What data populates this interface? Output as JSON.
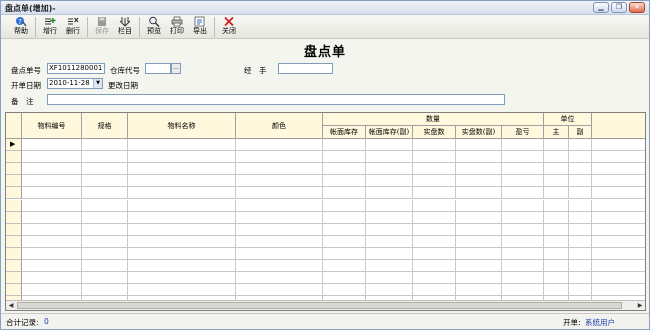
{
  "window": {
    "title": "盘点单(增加)-"
  },
  "toolbar": {
    "buttons": [
      {
        "label": "帮助",
        "icon": "help-icon"
      },
      {
        "label": "增行",
        "icon": "add-row-icon"
      },
      {
        "label": "删行",
        "icon": "delete-row-icon"
      },
      {
        "label": "保存",
        "icon": "save-icon"
      },
      {
        "label": "栏目",
        "icon": "columns-icon"
      },
      {
        "label": "预览",
        "icon": "preview-icon"
      },
      {
        "label": "打印",
        "icon": "print-icon"
      },
      {
        "label": "导出",
        "icon": "export-icon"
      },
      {
        "label": "关闭",
        "icon": "close-icon"
      }
    ]
  },
  "heading": "盘点单",
  "form": {
    "doc_no_label": "盘点单号",
    "doc_no_value": "XF1011280001",
    "warehouse_label": "仓库代号",
    "warehouse_value": "",
    "handler_label": "经　手",
    "handler_value": "",
    "date_label": "开单日期",
    "date_value": "2010-11-28",
    "change_date_label": "更改日期",
    "remark_label": "备　注",
    "remark_value": ""
  },
  "grid": {
    "headers": {
      "item_no": "物料编号",
      "spec": "规格",
      "item_name": "物料名称",
      "color": "颜色",
      "qty_group": "数量",
      "book_stock": "帐面库存",
      "book_stock_sub": "帐面库存(副)",
      "actual": "实盘数",
      "actual_sub": "实盘数(副)",
      "diff": "盈亏",
      "unit_group": "单位",
      "unit_main": "主",
      "unit_sub": "副"
    },
    "row_marker": "▶"
  },
  "status": {
    "total_label": "合计记录:",
    "total_value": "0",
    "creator_label": "开单:",
    "creator_value": "系统用户"
  },
  "colors": {
    "header_bg": "#fff8dc",
    "title_bar": "#d7e0ee",
    "accent_blue": "#1a3fb0"
  }
}
